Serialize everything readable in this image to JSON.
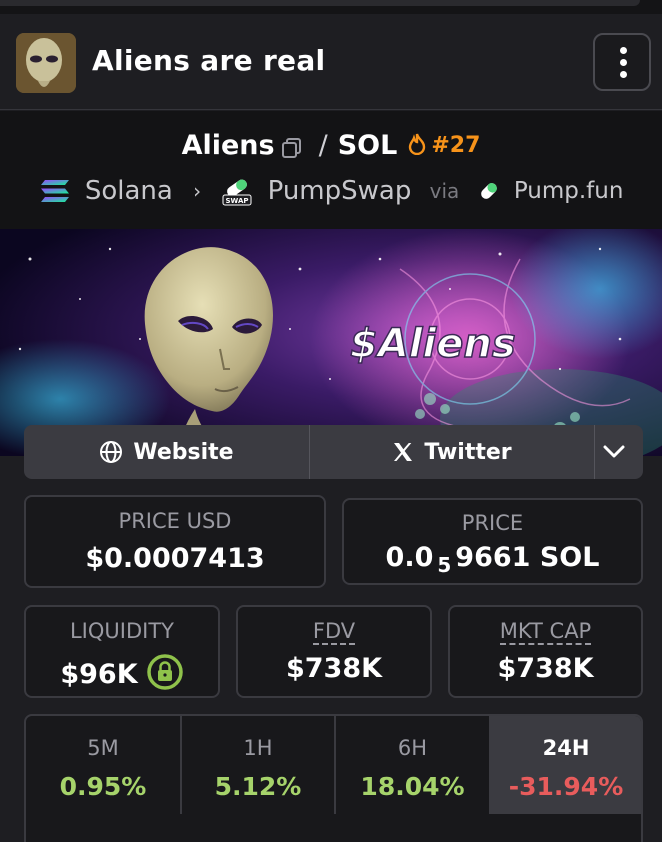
{
  "header": {
    "token_name": "Aliens are real"
  },
  "pair": {
    "base": "Aliens",
    "separator": "/",
    "quote": "SOL",
    "rank": "#27"
  },
  "chain": {
    "network": "Solana",
    "dex": "PumpSwap",
    "via": "via",
    "launchpad": "Pump.fun",
    "swap_badge": "SWAP"
  },
  "banner": {
    "ticker_text": "$Aliens"
  },
  "links": {
    "website": "Website",
    "twitter": "Twitter"
  },
  "stats": {
    "price_usd_label": "PRICE USD",
    "price_usd_value": "$0.0007413",
    "price_label": "PRICE",
    "price_value_prefix": "0.0",
    "price_value_zeros": "5",
    "price_value_suffix": "9661 SOL",
    "liquidity_label": "LIQUIDITY",
    "liquidity_value": "$96K",
    "fdv_label": "FDV",
    "fdv_value": "$738K",
    "mktcap_label": "MKT CAP",
    "mktcap_value": "$738K"
  },
  "changes": [
    {
      "period": "5M",
      "value": "0.95%",
      "color": "#a6d36b"
    },
    {
      "period": "1H",
      "value": "5.12%",
      "color": "#a6d36b"
    },
    {
      "period": "6H",
      "value": "18.04%",
      "color": "#a6d36b"
    },
    {
      "period": "24H",
      "value": "-31.94%",
      "color": "#e85c5c"
    }
  ],
  "colors": {
    "accent_orange": "#f7931a",
    "positive": "#a6d36b",
    "negative": "#e85c5c",
    "lock_green": "#8fc24b"
  }
}
